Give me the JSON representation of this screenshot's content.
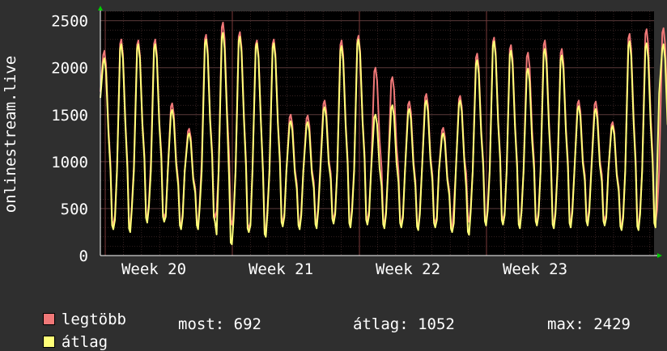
{
  "chart_data": {
    "type": "line",
    "ylabel": "onlinestream.live",
    "ylim": [
      0,
      2600
    ],
    "yticks": [
      0,
      500,
      1000,
      1500,
      2000,
      2500
    ],
    "x_tick_labels": [
      "Week 20",
      "Week 21",
      "Week 22",
      "Week 23"
    ],
    "grid": true,
    "colors": {
      "background": "#2f2f2f",
      "plot": "#000000",
      "grid": "#5a3a3a",
      "max_series": "#f07878",
      "avg_series": "#ffff78",
      "arrow": "#00cc00"
    },
    "series": [
      {
        "name": "legtöbb",
        "peaks": [
          2180,
          2300,
          2290,
          2300,
          1620,
          1350,
          2350,
          2480,
          2380,
          2290,
          2300,
          1500,
          1490,
          1650,
          2290,
          2340,
          2000,
          1900,
          1640,
          1720,
          1360,
          1700,
          2150,
          2320,
          2240,
          2160,
          2290,
          2200,
          1650,
          1640,
          1420,
          2360,
          2410,
          2420
        ],
        "troughs": [
          320,
          290,
          380,
          400,
          310,
          310,
          400,
          330,
          290,
          230,
          350,
          310,
          330,
          380,
          330,
          370,
          330,
          330,
          300,
          340,
          280,
          360,
          360,
          370,
          320,
          350,
          330,
          340,
          360,
          370,
          300,
          310,
          350,
          340
        ]
      },
      {
        "name": "átlag",
        "peaks": [
          2100,
          2250,
          2250,
          2250,
          1550,
          1300,
          2300,
          2370,
          2330,
          2260,
          2260,
          1430,
          1420,
          1580,
          2230,
          2300,
          1500,
          1600,
          1560,
          1650,
          1300,
          1650,
          2080,
          2280,
          2180,
          1990,
          2200,
          2130,
          1590,
          1560,
          1380,
          2280,
          2260,
          2250
        ],
        "troughs": [
          280,
          250,
          350,
          360,
          280,
          280,
          360,
          120,
          250,
          200,
          310,
          280,
          290,
          340,
          300,
          330,
          290,
          300,
          270,
          300,
          250,
          220,
          320,
          330,
          290,
          320,
          290,
          300,
          320,
          320,
          270,
          270,
          300,
          690
        ]
      }
    ]
  },
  "legend": [
    {
      "label": "legtöbb",
      "color": "#f07878"
    },
    {
      "label": "átlag",
      "color": "#ffff78"
    }
  ],
  "stats": {
    "now": "most: 692",
    "avg": "átlag: 1052",
    "max": "max: 2429"
  }
}
